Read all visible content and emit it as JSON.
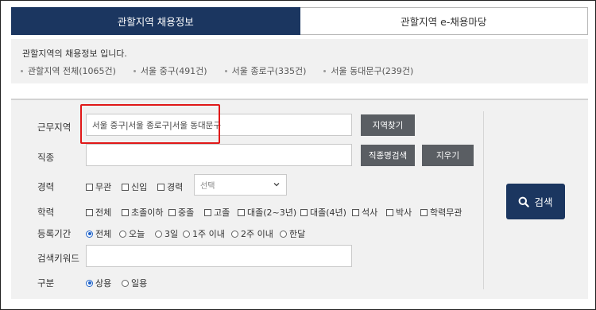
{
  "tabs": [
    {
      "label": "관할지역 채용정보",
      "active": true
    },
    {
      "label": "관할지역 e-채용마당",
      "active": false
    }
  ],
  "info": {
    "title": "관할지역의 채용정보 입니다.",
    "stats": [
      "관할지역 전체(1065건)",
      "서울 중구(491건)",
      "서울 종로구(335건)",
      "서울 동대문구(239건)"
    ]
  },
  "form": {
    "region": {
      "label": "근무지역",
      "value": "서울 중구|서울 종로구|서울 동대문구",
      "button": "지역찾기"
    },
    "job": {
      "label": "직종",
      "value": "",
      "search_button": "직종명검색",
      "clear_button": "지우기"
    },
    "career": {
      "label": "경력",
      "options": [
        "무관",
        "신입",
        "경력"
      ],
      "select_placeholder": "선택"
    },
    "education": {
      "label": "학력",
      "options": [
        "전체",
        "초졸이하",
        "중졸",
        "고졸",
        "대졸(2~3년)",
        "대졸(4년)",
        "석사",
        "박사",
        "학력무관"
      ]
    },
    "period": {
      "label": "등록기간",
      "options": [
        "전체",
        "오늘",
        "3일",
        "1주 이내",
        "2주 이내",
        "한달"
      ],
      "selected": "전체"
    },
    "keyword": {
      "label": "검색키워드",
      "value": ""
    },
    "type": {
      "label": "구분",
      "options": [
        "상용",
        "일용"
      ],
      "selected": "상용"
    },
    "search_button": "검색"
  },
  "colors": {
    "navy": "#1b3660",
    "gray_button": "#5a5e63",
    "highlight": "#e01818",
    "radio_accent": "#1e62c8"
  }
}
